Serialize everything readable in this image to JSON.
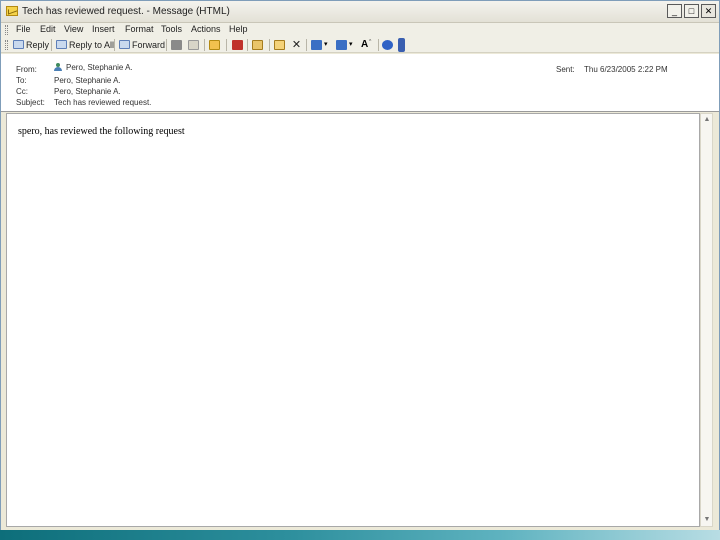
{
  "window": {
    "title": "Tech has reviewed request. - Message (HTML)",
    "controls": {
      "minimize": "_",
      "maximize": "□",
      "close": "✕"
    }
  },
  "menu": [
    "File",
    "Edit",
    "View",
    "Insert",
    "Format",
    "Tools",
    "Actions",
    "Help"
  ],
  "toolbar": {
    "reply": "Reply",
    "reply_all": "Reply to All",
    "forward": "Forward"
  },
  "header": {
    "from_label": "From:",
    "from_value": "Pero, Stephanie A.",
    "to_label": "To:",
    "to_value": "Pero, Stephanie A.",
    "cc_label": "Cc:",
    "cc_value": "Pero, Stephanie A.",
    "subject_label": "Subject:",
    "subject_value": "Tech has reviewed request.",
    "sent_label": "Sent:",
    "sent_value": "Thu 6/23/2005 2:22 PM"
  },
  "body": {
    "text": "spero, has reviewed the following request"
  },
  "colors": {
    "accent": "#3a5fb0",
    "taskbar": "#2d8f9d"
  }
}
